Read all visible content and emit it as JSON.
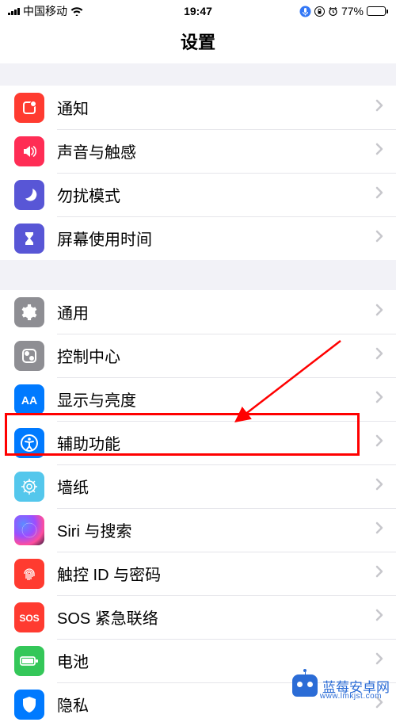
{
  "status": {
    "carrier": "中国移动",
    "time": "19:47",
    "battery_pct": "77%"
  },
  "title": "设置",
  "sections": [
    {
      "rows": [
        {
          "label": "通知"
        },
        {
          "label": "声音与触感"
        },
        {
          "label": "勿扰模式"
        },
        {
          "label": "屏幕使用时间"
        }
      ]
    },
    {
      "rows": [
        {
          "label": "通用"
        },
        {
          "label": "控制中心"
        },
        {
          "label": "显示与亮度"
        },
        {
          "label": "辅助功能"
        },
        {
          "label": "墙纸"
        },
        {
          "label": "Siri 与搜索"
        },
        {
          "label": "触控 ID 与密码"
        },
        {
          "label": "SOS 紧急联络"
        },
        {
          "label": "电池"
        },
        {
          "label": "隐私"
        }
      ]
    }
  ],
  "watermark": {
    "text": "蓝莓安卓网",
    "url": "www.lmkjst.com"
  }
}
